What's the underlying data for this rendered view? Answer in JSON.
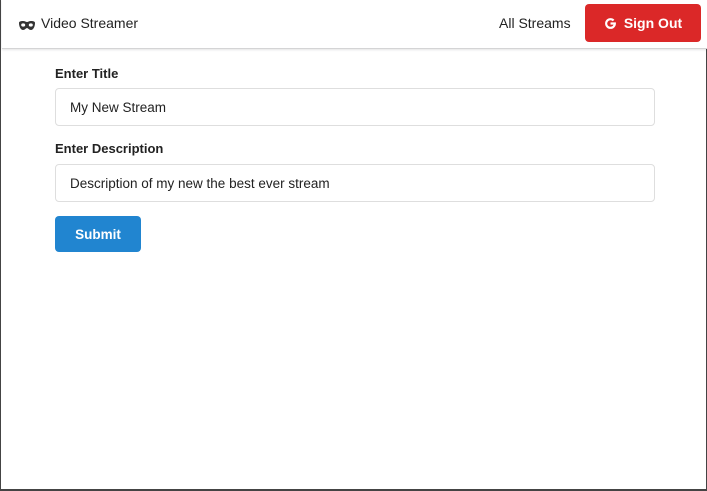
{
  "header": {
    "brand_icon": "mask-icon",
    "brand_label": "Video Streamer",
    "nav_link": "All Streams",
    "signout_icon": "google-icon",
    "signout_label": "Sign Out"
  },
  "form": {
    "title_label": "Enter Title",
    "title_value": "My New Stream",
    "description_label": "Enter Description",
    "description_value": "Description of my new the best ever stream",
    "submit_label": "Submit"
  },
  "colors": {
    "signout_bg": "#db2828",
    "submit_bg": "#2185d0"
  }
}
